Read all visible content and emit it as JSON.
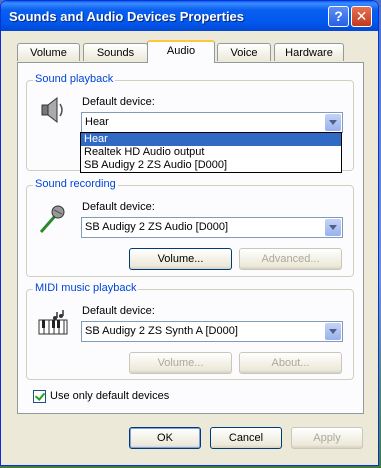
{
  "window": {
    "title": "Sounds and Audio Devices Properties",
    "help_glyph": "?",
    "close_glyph": "✕"
  },
  "tabs": [
    {
      "label": "Volume"
    },
    {
      "label": "Sounds"
    },
    {
      "label": "Audio"
    },
    {
      "label": "Voice"
    },
    {
      "label": "Hardware"
    }
  ],
  "playback": {
    "title": "Sound playback",
    "default_label": "Default device:",
    "selected": "Hear",
    "options": [
      "Hear",
      "Realtek HD Audio output",
      "SB Audigy 2 ZS Audio [D000]"
    ]
  },
  "recording": {
    "title": "Sound recording",
    "default_label": "Default device:",
    "selected": "SB Audigy 2 ZS Audio [D000]",
    "volume_button": "Volume...",
    "advanced_button": "Advanced..."
  },
  "midi": {
    "title": "MIDI music playback",
    "default_label": "Default device:",
    "selected": "SB Audigy 2 ZS Synth A [D000]",
    "volume_button": "Volume...",
    "about_button": "About..."
  },
  "use_default_only": {
    "label": "Use only default devices",
    "checked": true
  },
  "footer": {
    "ok": "OK",
    "cancel": "Cancel",
    "apply": "Apply"
  },
  "colors": {
    "title_bar": "#0058ee",
    "group_title": "#0046d5",
    "selection": "#316ac5"
  }
}
